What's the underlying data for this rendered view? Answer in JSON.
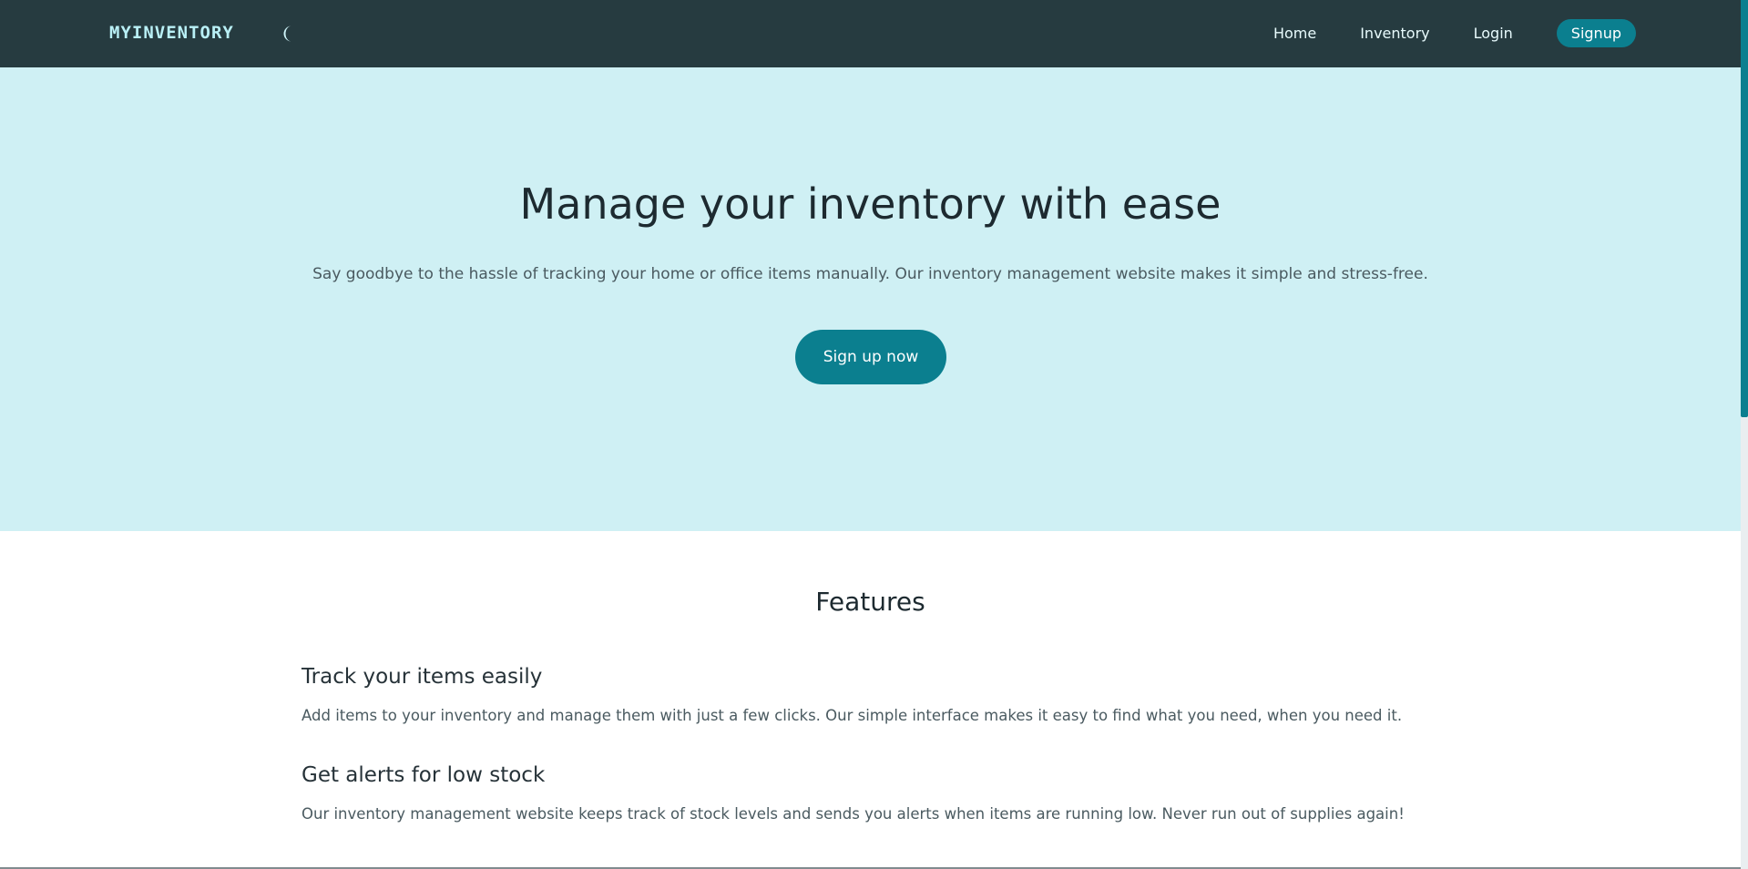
{
  "navbar": {
    "brand": "MYINVENTORY",
    "theme_toggle_icon": "moon-icon",
    "links": [
      "Home",
      "Inventory",
      "Login"
    ],
    "signup_label": "Signup",
    "background": "#263b40",
    "accent": "#0b7f8f"
  },
  "hero": {
    "title": "Manage your inventory with ease",
    "subtitle": "Say goodbye to the hassle of tracking your home or office items manually. Our inventory management website makes it simple and stress-free.",
    "cta_label": "Sign up now",
    "background": "#cff0f4"
  },
  "features": {
    "title": "Features",
    "items": [
      {
        "title": "Track your items easily",
        "description": "Add items to your inventory and manage them with just a few clicks. Our simple interface makes it easy to find what you need, when you need it."
      },
      {
        "title": "Get alerts for low stock",
        "description": "Our inventory management website keeps track of stock levels and sends you alerts when items are running low. Never run out of supplies again!"
      }
    ]
  }
}
